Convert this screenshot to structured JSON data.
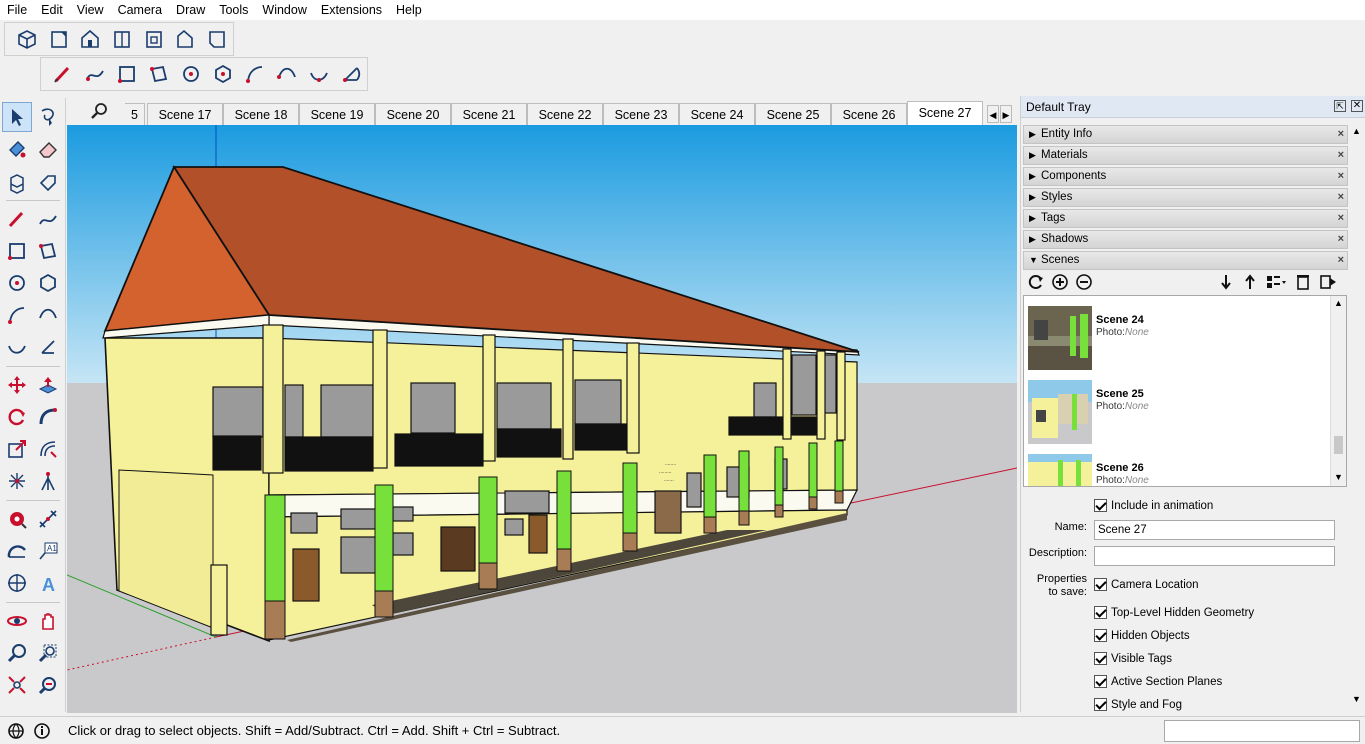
{
  "menu": [
    "File",
    "Edit",
    "View",
    "Camera",
    "Draw",
    "Tools",
    "Window",
    "Extensions",
    "Help"
  ],
  "views_toolbar": [
    "iso-view-icon",
    "top-view-icon",
    "front-view-icon",
    "right-view-icon",
    "back-view-icon",
    "left-view-icon",
    "bottom-view-icon"
  ],
  "draw_toolbar": [
    "pencil-icon",
    "freehand-icon",
    "rectangle-icon",
    "rotated-rectangle-icon",
    "circle-icon",
    "polygon-icon",
    "arc-icon",
    "two-point-arc-icon",
    "three-point-arc-icon",
    "pie-icon"
  ],
  "scene_tabs": {
    "partial": "5",
    "tabs": [
      "Scene 17",
      "Scene 18",
      "Scene 19",
      "Scene 20",
      "Scene 21",
      "Scene 22",
      "Scene 23",
      "Scene 24",
      "Scene 25",
      "Scene 26",
      "Scene 27"
    ],
    "active": "Scene 27"
  },
  "tray": {
    "title": "Default Tray",
    "panels": [
      "Entity Info",
      "Materials",
      "Components",
      "Styles",
      "Tags",
      "Shadows",
      "Scenes"
    ],
    "scenes_list": [
      {
        "name": "Scene 24",
        "photo_label": "Photo:",
        "photo_value": "None"
      },
      {
        "name": "Scene 25",
        "photo_label": "Photo:",
        "photo_value": "None"
      },
      {
        "name": "Scene 26",
        "photo_label": "Photo:",
        "photo_value": "None"
      }
    ],
    "include_in_animation": "Include in animation",
    "name_label": "Name:",
    "name_value": "Scene 27",
    "description_label": "Description:",
    "description_value": "",
    "properties_label_1": "Properties",
    "properties_label_2": "to save:",
    "properties": [
      "Camera Location",
      "Top-Level Hidden Geometry",
      "Hidden Objects",
      "Visible Tags",
      "Active Section Planes",
      "Style and Fog"
    ]
  },
  "building_sign": [
    "........",
    ".........",
    "......."
  ],
  "status": {
    "text": "Click or drag to select objects. Shift = Add/Subtract. Ctrl = Add. Shift + Ctrl = Subtract.",
    "measurements_value": ""
  },
  "colors": {
    "sky_top": "#1b9be0",
    "sky_bottom": "#c5e5f5",
    "ground": "#c9c9cc",
    "roof": "#b2502a",
    "roof_gable": "#d4622f",
    "wall": "#f5f09a",
    "column": "#77e03a",
    "accent_blue": "#0050c0"
  }
}
